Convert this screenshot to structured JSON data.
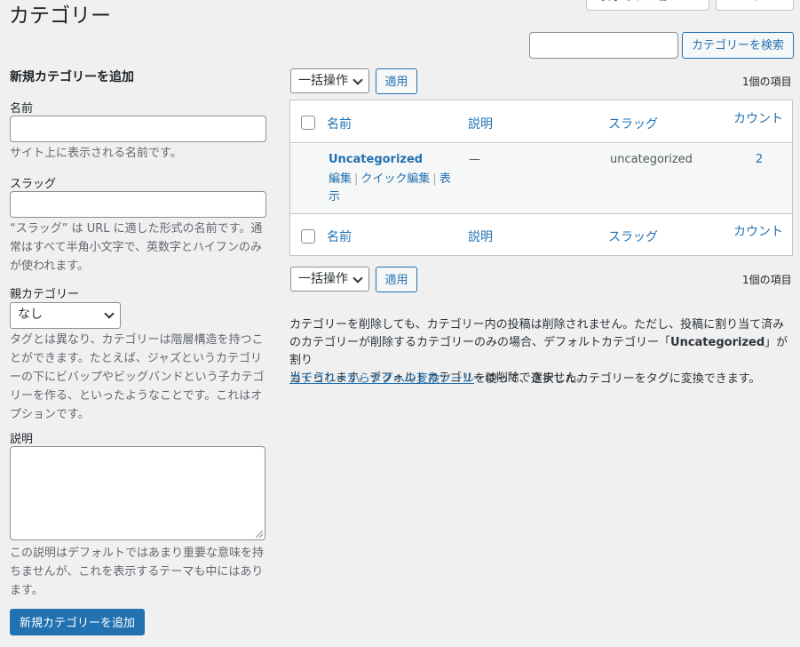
{
  "page": {
    "title": "カテゴリー"
  },
  "screen_tabs": {
    "display_options": "表示オプション",
    "help": "ヘルプ"
  },
  "search": {
    "value": "",
    "button": "カテゴリーを検索"
  },
  "form": {
    "heading": "新規カテゴリーを追加",
    "name_label": "名前",
    "name_desc": "サイト上に表示される名前です。",
    "slug_label": "スラッグ",
    "slug_desc_line1": "“スラッグ” は URL に適した形式の名前です。通",
    "slug_desc_line2": "常はすべて半角小文字で、英数字とハイフンのみ",
    "slug_desc_line3": "が使われます。",
    "parent_label": "親カテゴリー",
    "parent_selected": "なし",
    "parent_desc_line1": "タグとは異なり、カテゴリーは階層構造を持つこ",
    "parent_desc_line2": "とができます。たとえば、ジャズというカテゴリ",
    "parent_desc_line3": "ーの下にビバップやビッグバンドという子カテゴ",
    "parent_desc_line4": "リーを作る、といったようなことです。これはオ",
    "parent_desc_line5": "プションです。",
    "desc_label": "説明",
    "desc_desc_line1": "この説明はデフォルトではあまり重要な意味を持",
    "desc_desc_line2": "ちませんが、これを表示するテーマも中にはあり",
    "desc_desc_line3": "ます。",
    "submit": "新規カテゴリーを追加"
  },
  "tablenav": {
    "bulk_label": "一括操作",
    "apply": "適用",
    "items_count": "1個の項目"
  },
  "table": {
    "columns": {
      "name": "名前",
      "description": "説明",
      "slug": "スラッグ",
      "count": "カウント"
    },
    "rows": [
      {
        "name": "Uncategorized",
        "actions": {
          "edit": "編集",
          "quick_edit": "クイック編集",
          "view_1": "表",
          "view_2": "示"
        },
        "description": "—",
        "slug": "uncategorized",
        "count": "2"
      }
    ]
  },
  "notes": {
    "line1": "カテゴリーを削除しても、カテゴリー内の投稿は削除されません。ただし、投稿に割り当て済み",
    "line2_a": "のカテゴリーが削除するカテゴリーのみの場合、デフォルトカテゴリー「",
    "line2_bold": "Uncategorized",
    "line2_b": "」が割り",
    "line3": "当てられます。デフォルトカテゴリーは削除できません。",
    "converter_link": "カテゴリーからタグへの変換ツール",
    "converter_rest": "を使って、選択したカテゴリーをタグに変換できます。"
  }
}
